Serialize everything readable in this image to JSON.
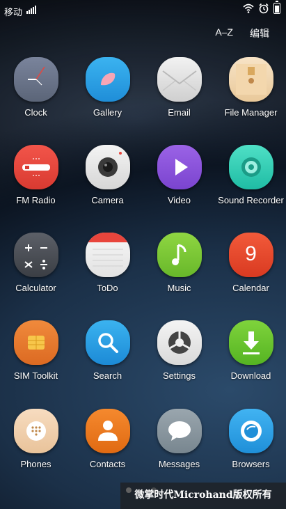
{
  "status": {
    "carrier": "移动"
  },
  "top_actions": {
    "sort": "A–Z",
    "edit": "编辑"
  },
  "apps": [
    {
      "label": "Clock",
      "icon": "clock-icon"
    },
    {
      "label": "Gallery",
      "icon": "gallery-icon"
    },
    {
      "label": "Email",
      "icon": "email-icon"
    },
    {
      "label": "File Manager",
      "icon": "file-manager-icon"
    },
    {
      "label": "FM Radio",
      "icon": "radio-icon"
    },
    {
      "label": "Camera",
      "icon": "camera-icon"
    },
    {
      "label": "Video",
      "icon": "video-icon"
    },
    {
      "label": "Sound Recorder",
      "icon": "recorder-icon"
    },
    {
      "label": "Calculator",
      "icon": "calculator-icon"
    },
    {
      "label": "ToDo",
      "icon": "todo-icon"
    },
    {
      "label": "Music",
      "icon": "music-icon"
    },
    {
      "label": "Calendar",
      "icon": "calendar-icon",
      "value": "9"
    },
    {
      "label": "SIM Toolkit",
      "icon": "sim-icon"
    },
    {
      "label": "Search",
      "icon": "search-icon"
    },
    {
      "label": "Settings",
      "icon": "settings-icon"
    },
    {
      "label": "Download",
      "icon": "download-icon"
    },
    {
      "label": "Phones",
      "icon": "phone-icon"
    },
    {
      "label": "Contacts",
      "icon": "contacts-icon"
    },
    {
      "label": "Messages",
      "icon": "messages-icon"
    },
    {
      "label": "Browsers",
      "icon": "browser-icon"
    }
  ],
  "watermark": "微掌时代Microhand版权所有",
  "colors": {
    "accent": "#ffffff"
  }
}
